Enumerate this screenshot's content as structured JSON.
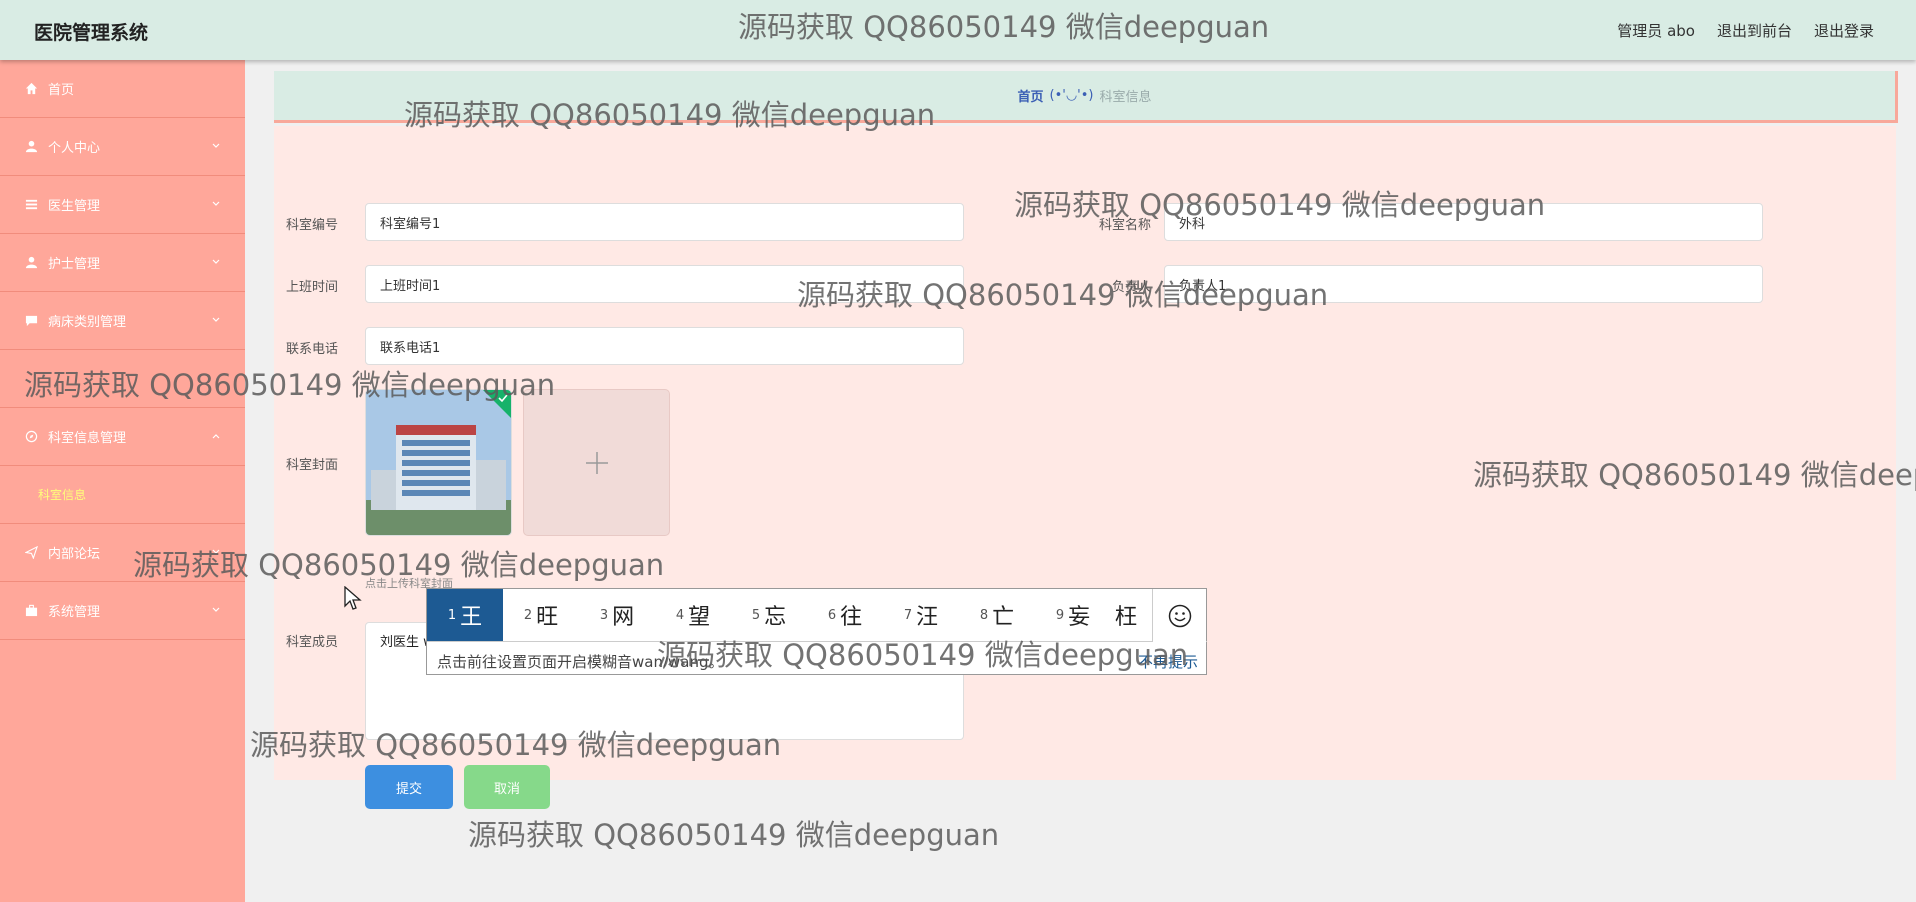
{
  "header": {
    "app_title": "医院管理系统",
    "links": [
      "管理员 abo",
      "退出到前台",
      "退出登录"
    ]
  },
  "sidebar": {
    "items": [
      {
        "label": "首页",
        "icon": "home-icon"
      },
      {
        "label": "个人中心",
        "icon": "user-icon"
      },
      {
        "label": "医生管理",
        "icon": "list-icon"
      },
      {
        "label": "护士管理",
        "icon": "user-icon"
      },
      {
        "label": "病床类别管理",
        "icon": "chat-icon"
      },
      {
        "label": "",
        "icon": ""
      },
      {
        "label": "科室信息管理",
        "icon": "compass-icon"
      },
      {
        "label": "内部论坛",
        "icon": "send-icon"
      },
      {
        "label": "系统管理",
        "icon": "briefcase-icon"
      }
    ],
    "sub_item": "科室信息"
  },
  "breadcrumb": {
    "home": "首页",
    "separator": "(•'◡'•)",
    "current": "科室信息"
  },
  "form": {
    "dept_no_label": "科室编号",
    "dept_no_value": "科室编号1",
    "dept_name_label": "科室名称",
    "dept_name_value": "外科",
    "shift_label": "上班时间",
    "shift_value": "上班时间1",
    "leader_label": "负责人",
    "leader_value": "负责人1",
    "phone_label": "联系电话",
    "phone_value": "联系电话1",
    "cover_label": "科室封面",
    "cover_hint": "点击上传科室封面",
    "members_label": "科室成员",
    "members_value": "刘医生 wang",
    "submit_label": "提交",
    "cancel_label": "取消"
  },
  "ime": {
    "candidates": [
      {
        "n": "1",
        "c": "王"
      },
      {
        "n": "2",
        "c": "旺"
      },
      {
        "n": "3",
        "c": "网"
      },
      {
        "n": "4",
        "c": "望"
      },
      {
        "n": "5",
        "c": "忘"
      },
      {
        "n": "6",
        "c": "往"
      },
      {
        "n": "7",
        "c": "汪"
      },
      {
        "n": "8",
        "c": "亡"
      },
      {
        "n": "9",
        "c": "妄"
      },
      {
        "n": "",
        "c": "枉"
      }
    ],
    "tip": "点击前往设置页面开启模糊音wan/wang。",
    "tip_link": "不再提示"
  },
  "watermark": "源码获取 QQ86050149 微信deepguan",
  "colors": {
    "header_bg": "#d9ece4",
    "sidebar_bg": "#ffa79a",
    "panel_bg": "#ffe9e5",
    "submit_bg": "#3d8fe0",
    "cancel_bg": "#86d98a",
    "active_sub": "#fffd7a",
    "ime_selected": "#1d5a93"
  }
}
